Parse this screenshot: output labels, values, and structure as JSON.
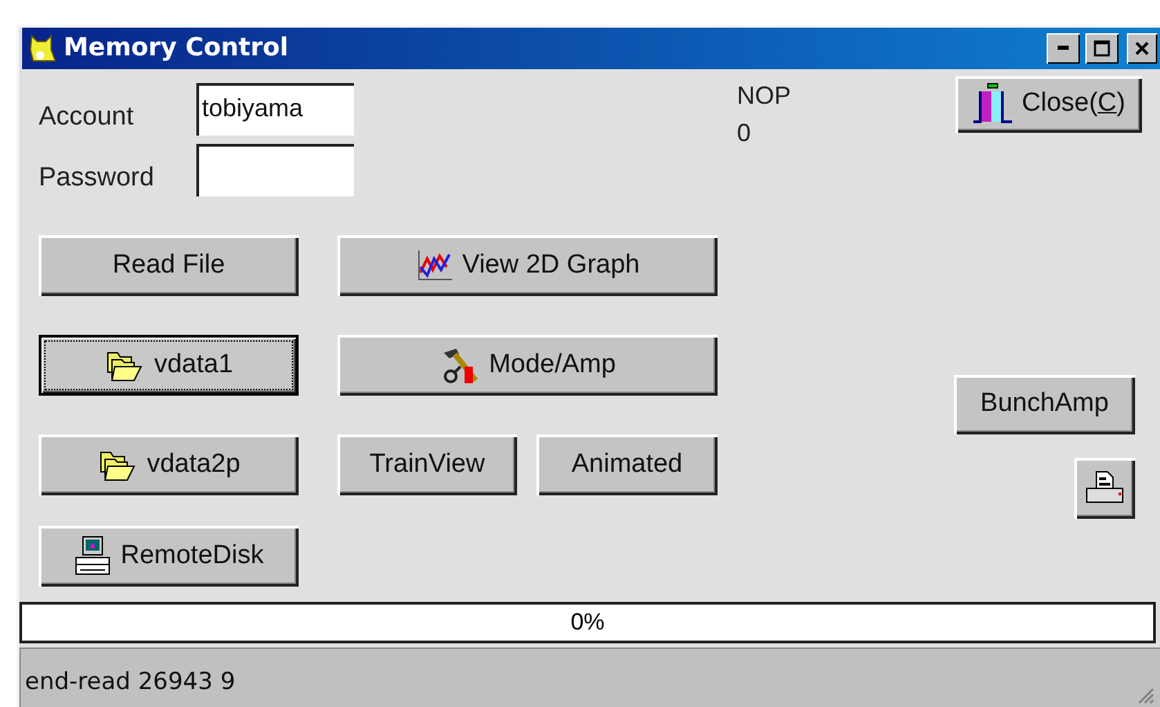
{
  "window": {
    "title": "Memory Control"
  },
  "fields": [
    {
      "label": "Account",
      "value": "tobiyama"
    },
    {
      "label": "Password"
    }
  ],
  "nop": {
    "label": "NOP",
    "value": "0"
  },
  "buttons": [
    {
      "label": "Close(C)",
      "focused": false
    },
    {
      "label": "Read File",
      "focused": false
    },
    {
      "label": "View 2D Graph",
      "focused": false
    },
    {
      "label": "vdata1",
      "focused": true
    },
    {
      "label": "Mode/Amp",
      "focused": false
    },
    {
      "label": "BunchAmp",
      "focused": false
    },
    {
      "label": "vdata2p",
      "focused": false
    },
    {
      "label": "TrainView",
      "focused": false
    },
    {
      "label": "Animated",
      "focused": false
    },
    {
      "focused": false
    },
    {
      "label": "RemoteDisk",
      "focused": false
    }
  ],
  "progress": {
    "level": 0,
    "text": "0%"
  },
  "status_bar": {
    "text": "end-read 26943 9"
  }
}
